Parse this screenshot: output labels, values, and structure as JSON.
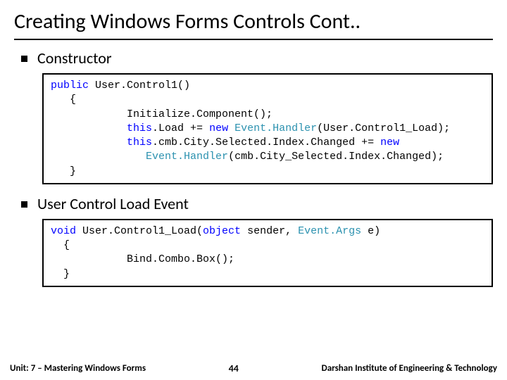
{
  "title": "Creating Windows Forms Controls Cont..",
  "sections": [
    {
      "label": "Constructor"
    },
    {
      "label": "User Control Load Event"
    }
  ],
  "code1": {
    "l1a": "public",
    "l1b": " User.Control1()",
    "l2": "   {",
    "l3": "            Initialize.Component();",
    "l4a": "            ",
    "l4b": "this",
    "l4c": ".Load += ",
    "l4d": "new",
    "l4e": " ",
    "l4f": "Event.Handler",
    "l4g": "(User.Control1_Load);",
    "l5a": "            ",
    "l5b": "this",
    "l5c": ".cmb.City.Selected.Index.Changed += ",
    "l5d": "new",
    "l6a": "               ",
    "l6b": "Event.Handler",
    "l6c": "(cmb.City_Selected.Index.Changed);",
    "l7": "   }"
  },
  "code2": {
    "l1a": "void",
    "l1b": " User.Control1_Load(",
    "l1c": "object",
    "l1d": " sender, ",
    "l1e": "Event.Args",
    "l1f": " e)",
    "l2": "  {",
    "l3": "            Bind.Combo.Box();",
    "l4": "  }"
  },
  "footer": {
    "unit": "Unit: 7 – Mastering Windows Forms",
    "page": "44",
    "org": "Darshan Institute of Engineering & Technology"
  }
}
